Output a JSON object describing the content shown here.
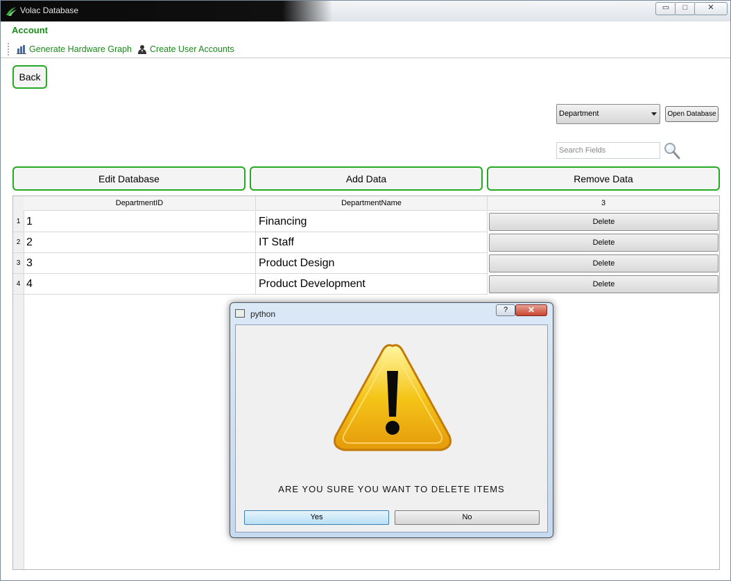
{
  "window": {
    "title": "Volac Database",
    "controls": {
      "minimize": "▭",
      "maximize": "□",
      "close": "✕"
    }
  },
  "menu": {
    "title": "Account"
  },
  "toolbar": {
    "items": [
      {
        "label": "Generate Hardware Graph",
        "icon": "bar-chart-icon"
      },
      {
        "label": "Create User Accounts",
        "icon": "user-icon"
      }
    ]
  },
  "nav": {
    "back_label": "Back"
  },
  "controls": {
    "dropdown_value": "Department",
    "open_db_label": "Open Database",
    "search_placeholder": "Search Fields"
  },
  "actions": {
    "edit": "Edit Database",
    "add": "Add Data",
    "remove": "Remove Data"
  },
  "table": {
    "headers": [
      "DepartmentID",
      "DepartmentName",
      "3"
    ],
    "rows": [
      {
        "num": "1",
        "id": "1",
        "name": "Financing",
        "action": "Delete"
      },
      {
        "num": "2",
        "id": "2",
        "name": "IT Staff",
        "action": "Delete"
      },
      {
        "num": "3",
        "id": "3",
        "name": "Product Design",
        "action": "Delete"
      },
      {
        "num": "4",
        "id": "4",
        "name": "Product Development",
        "action": "Delete"
      }
    ]
  },
  "dialog": {
    "title": "python",
    "help": "?",
    "close": "✕",
    "message": "ARE YOU SURE YOU WANT TO DELETE ITEMS",
    "yes": "Yes",
    "no": "No",
    "icon": "warning-icon"
  }
}
